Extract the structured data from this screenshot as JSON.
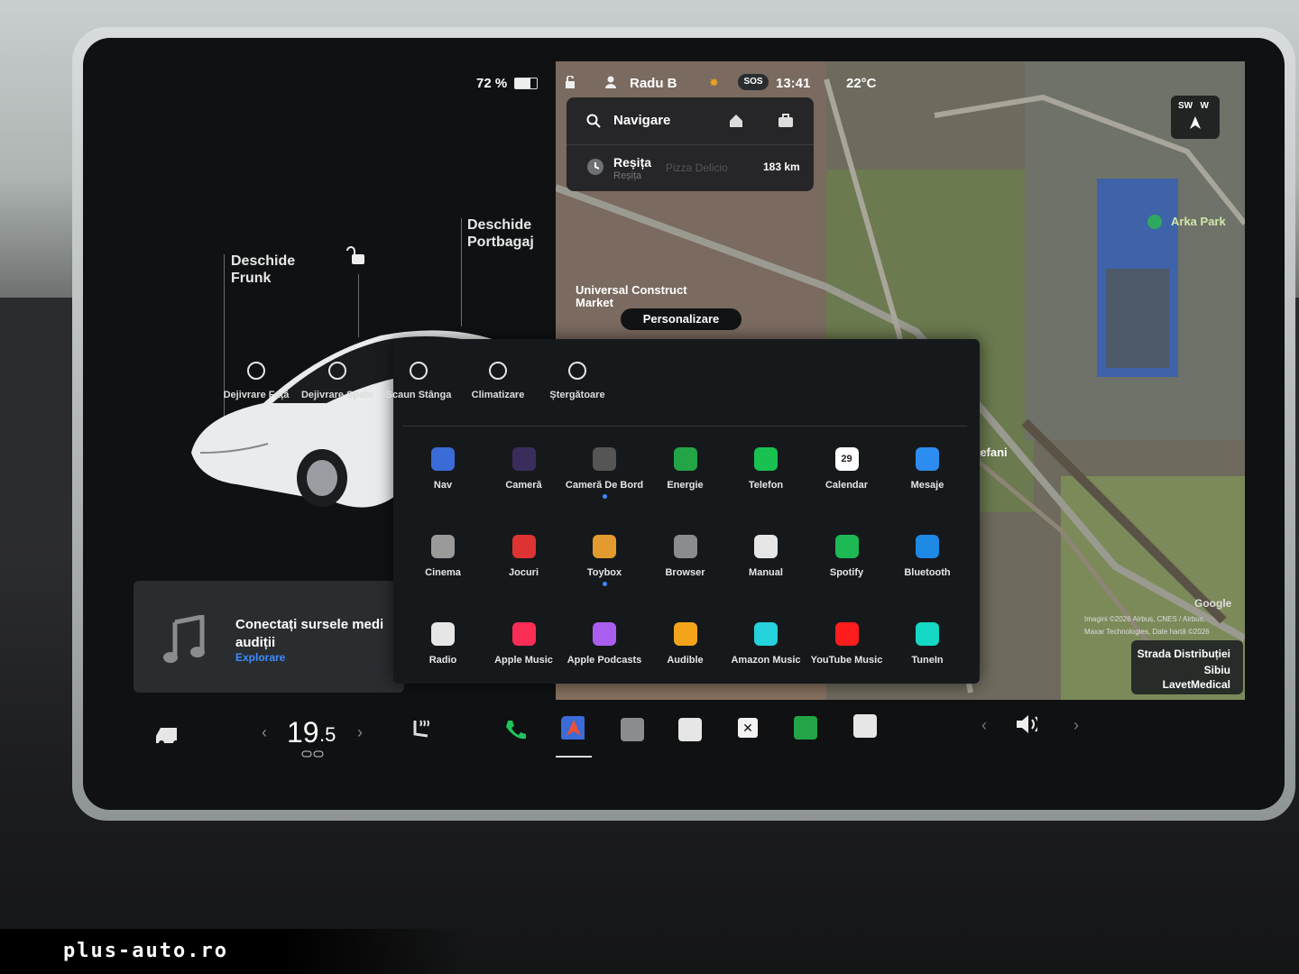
{
  "status_bar": {
    "battery": "72 %",
    "user": "Radu B",
    "sos": "SOS",
    "time": "13:41",
    "temperature": "22°C"
  },
  "navigation": {
    "search_label": "Navigare",
    "recent_title": "Reșița",
    "recent_subtitle": "Reșița",
    "recent_ghost": "Pizza Delicio",
    "recent_distance": "183 km",
    "compass_label": "SW   W",
    "personalize_label": "Personalizare"
  },
  "map_labels": {
    "poi_1": "Arka Park",
    "poi_2": "Universal Construct",
    "poi_2b": "Market",
    "area": "tefani",
    "google": "Google",
    "attribution_1": "Imagini ©2026 Airbus, CNES / Airbus,",
    "attribution_2": "Maxar Technologies, Date hartă ©2026",
    "street_1": "Strada Distribuției",
    "street_2": "Sibiu",
    "street_3": "LavetMedical"
  },
  "car_panel": {
    "frunk_line1": "Deschide",
    "frunk_line2": "Frunk",
    "trunk_line1": "Deschide",
    "trunk_line2": "Portbagaj"
  },
  "media": {
    "title_line1": "Conectați sursele medi",
    "title_line2": "audiții",
    "link": "Explorare"
  },
  "quick_controls": [
    {
      "label": "Dejivrare Față",
      "icon": "front-defrost-icon"
    },
    {
      "label": "Dejivrare Spate",
      "icon": "rear-defrost-icon"
    },
    {
      "label": "Scaun Stânga",
      "icon": "seat-heater-icon"
    },
    {
      "label": "Climatizare",
      "icon": "fan-icon"
    },
    {
      "label": "Ștergătoare",
      "icon": "wiper-icon"
    }
  ],
  "apps": [
    {
      "label": "Nav",
      "icon": "nav-icon",
      "color": "#3b6bd6"
    },
    {
      "label": "Cameră",
      "icon": "camera-icon",
      "color": "#3a2d5c"
    },
    {
      "label": "Cameră De Bord",
      "icon": "dashcam-icon",
      "color": "#555",
      "dot": true
    },
    {
      "label": "Energie",
      "icon": "energy-icon",
      "color": "#22a447"
    },
    {
      "label": "Telefon",
      "icon": "phone-icon",
      "color": "#19c150"
    },
    {
      "label": "Calendar",
      "icon": "calendar-icon",
      "color": "#ffffff",
      "badge": "29"
    },
    {
      "label": "Mesaje",
      "icon": "messages-icon",
      "color": "#2d8cf0"
    },
    {
      "label": "Cinema",
      "icon": "cinema-icon",
      "color": "#9a9a9a"
    },
    {
      "label": "Jocuri",
      "icon": "joystick-icon",
      "color": "#d33"
    },
    {
      "label": "Toybox",
      "icon": "toybox-icon",
      "color": "#e39b2f",
      "dot": true
    },
    {
      "label": "Browser",
      "icon": "browser-icon",
      "color": "#8a8d90"
    },
    {
      "label": "Manual",
      "icon": "manual-icon",
      "color": "#e6e6e6"
    },
    {
      "label": "Spotify",
      "icon": "spotify-icon",
      "color": "#1db954"
    },
    {
      "label": "Bluetooth",
      "icon": "bluetooth-icon",
      "color": "#1e88e5"
    },
    {
      "label": "Radio",
      "icon": "radio-icon",
      "color": "#e6e6e6"
    },
    {
      "label": "Apple Music",
      "icon": "apple-music-icon",
      "color": "#fa2d55"
    },
    {
      "label": "Apple Podcasts",
      "icon": "podcasts-icon",
      "color": "#a95ef0"
    },
    {
      "label": "Audible",
      "icon": "audible-icon",
      "color": "#f3a41a"
    },
    {
      "label": "Amazon Music",
      "icon": "amazon-music-icon",
      "color": "#25d1da"
    },
    {
      "label": "YouTube Music",
      "icon": "youtube-music-icon",
      "color": "#ff1c1c"
    },
    {
      "label": "TuneIn",
      "icon": "tunein-icon",
      "color": "#14d8c4"
    }
  ],
  "dock": {
    "temp_int": "19",
    "temp_dec": ".5",
    "arrow_left": "‹",
    "arrow_right": "›"
  },
  "watermark": "plus-auto.ro"
}
